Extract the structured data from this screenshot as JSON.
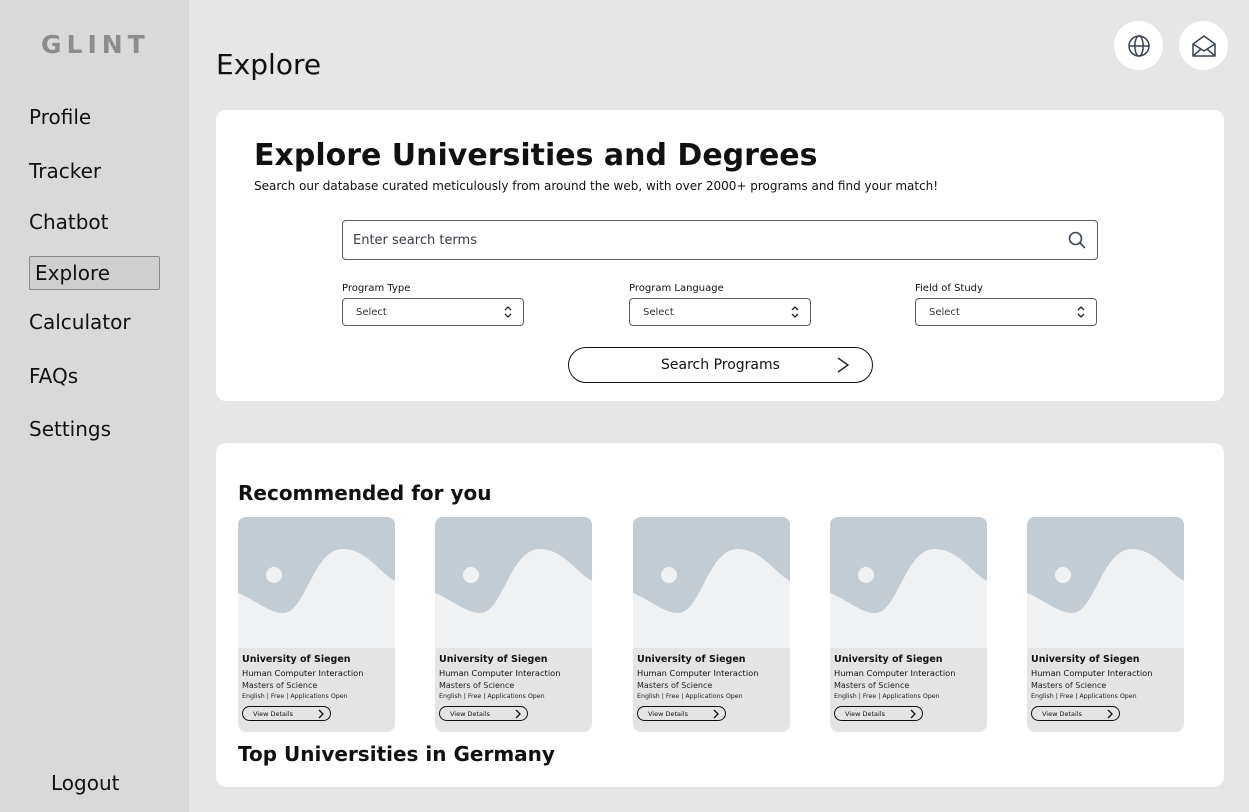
{
  "app": {
    "logo": "GLINT"
  },
  "sidebar": {
    "items": [
      {
        "label": "Profile"
      },
      {
        "label": "Tracker"
      },
      {
        "label": "Chatbot"
      },
      {
        "label": "Explore",
        "active": true
      },
      {
        "label": "Calculator"
      },
      {
        "label": "FAQs"
      },
      {
        "label": "Settings"
      }
    ],
    "logout": "Logout"
  },
  "header": {
    "title": "Explore",
    "icons": [
      "globe-icon",
      "mail-icon"
    ]
  },
  "search_section": {
    "title": "Explore Universities and Degrees",
    "subtitle": "Search our database curated meticulously from around the web, with over 2000+ programs and find your match!",
    "search_placeholder": "Enter search terms",
    "filters": [
      {
        "label": "Program Type",
        "value": "Select"
      },
      {
        "label": "Program Language",
        "value": "Select"
      },
      {
        "label": "Field of Study",
        "value": "Select"
      }
    ],
    "search_button": "Search Programs"
  },
  "recommended": {
    "title": "Recommended for you",
    "programs": [
      {
        "university": "University of Siegen",
        "course": "Human Computer Interaction",
        "degree": "Masters of Science",
        "meta": "English | Free | Applications Open",
        "button": "View Details"
      },
      {
        "university": "University of Siegen",
        "course": "Human Computer Interaction",
        "degree": "Masters of Science",
        "meta": "English | Free | Applications Open",
        "button": "View Details"
      },
      {
        "university": "University of Siegen",
        "course": "Human Computer Interaction",
        "degree": "Masters of Science",
        "meta": "English | Free | Applications Open",
        "button": "View Details"
      },
      {
        "university": "University of Siegen",
        "course": "Human Computer Interaction",
        "degree": "Masters of Science",
        "meta": "English | Free | Applications Open",
        "button": "View Details"
      },
      {
        "university": "University of Siegen",
        "course": "Human Computer Interaction",
        "degree": "Masters of Science",
        "meta": "English | Free | Applications Open",
        "button": "View Details"
      }
    ]
  },
  "top_universities": {
    "title": "Top Universities in Germany"
  },
  "colors": {
    "background": "#e6e6e6",
    "sidebar": "#d9d9d9",
    "card": "#ffffff",
    "placeholder_image": "#c3cbd3",
    "placeholder_hill": "#f0f1f3",
    "logo": "#8c8c8c"
  }
}
